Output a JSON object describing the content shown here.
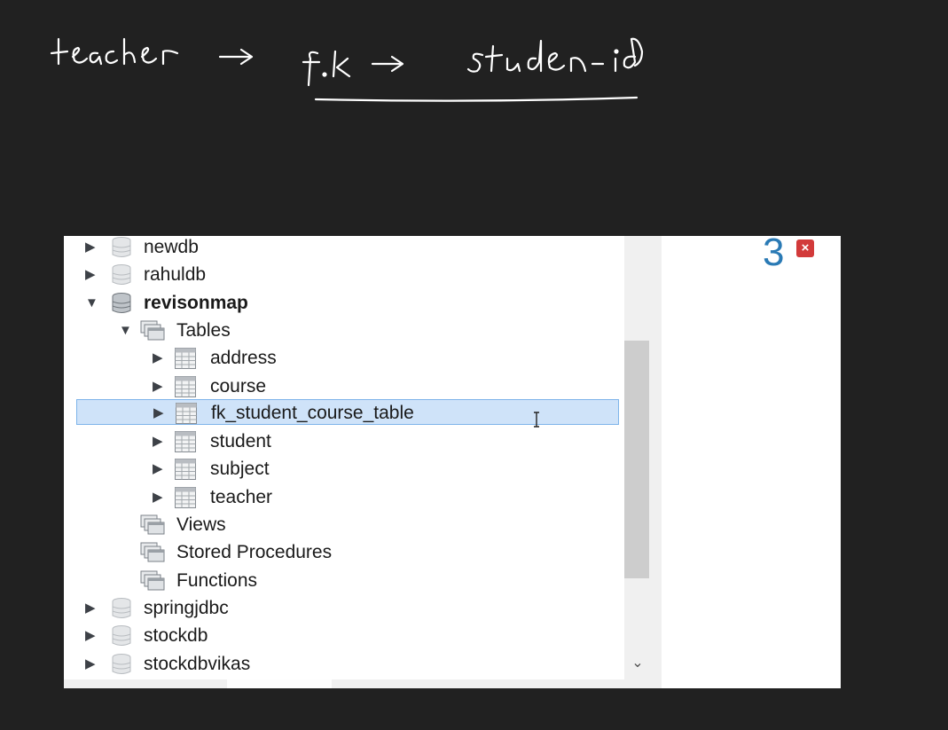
{
  "annotation": {
    "line1": "teacher → f.k → studen-id"
  },
  "tree": {
    "items": [
      {
        "label": "newdb",
        "type": "schema",
        "expanded": false
      },
      {
        "label": "rahuldb",
        "type": "schema",
        "expanded": false
      },
      {
        "label": "revisonmap",
        "type": "schema",
        "expanded": true
      },
      {
        "label": "Tables",
        "type": "folder",
        "expanded": true
      },
      {
        "label": "address",
        "type": "table",
        "expanded": false
      },
      {
        "label": "course",
        "type": "table",
        "expanded": false
      },
      {
        "label": "fk_student_course_table",
        "type": "table",
        "expanded": false,
        "selected": true
      },
      {
        "label": "student",
        "type": "table",
        "expanded": false
      },
      {
        "label": "subject",
        "type": "table",
        "expanded": false
      },
      {
        "label": "teacher",
        "type": "table",
        "expanded": false
      },
      {
        "label": "Views",
        "type": "folder"
      },
      {
        "label": "Stored Procedures",
        "type": "folder"
      },
      {
        "label": "Functions",
        "type": "folder"
      },
      {
        "label": "springjdbc",
        "type": "schema",
        "expanded": false
      },
      {
        "label": "stockdb",
        "type": "schema",
        "expanded": false
      },
      {
        "label": "stockdbvikas",
        "type": "schema",
        "expanded": false
      }
    ]
  },
  "right_panel": {
    "count": "3",
    "close_icon": "×"
  },
  "colors": {
    "selection_bg": "#cfe3f9",
    "selection_border": "#7eb4ea",
    "count_color": "#2a7ab5",
    "close_color": "#d23a3a"
  }
}
